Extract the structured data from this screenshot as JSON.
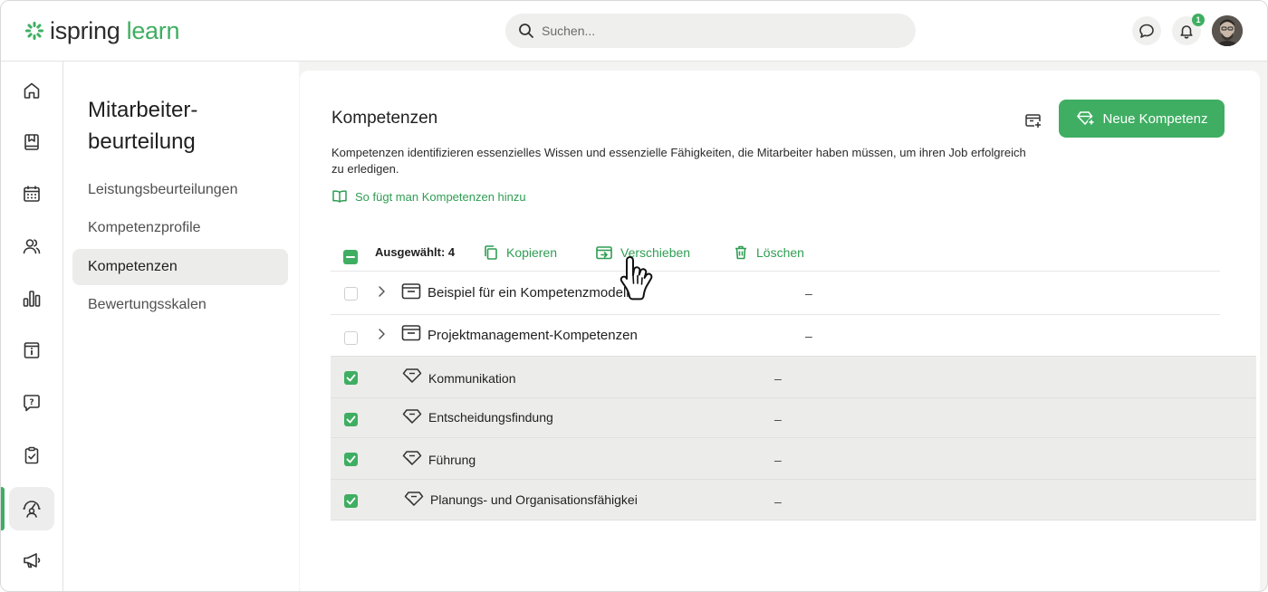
{
  "header": {
    "logo": {
      "part1": "ispring",
      "part2": "learn"
    },
    "search_placeholder": "Suchen...",
    "notification_count": "1"
  },
  "rail": {
    "items": [
      "home-icon",
      "book-icon",
      "calendar-icon",
      "users-icon",
      "chart-icon",
      "info-card-icon",
      "question-icon",
      "clipboard-check-icon",
      "evaluation-icon",
      "megaphone-icon"
    ],
    "active_index": 8
  },
  "subnav": {
    "title": "Mitarbeiter-beurteilung",
    "items": [
      "Leistungsbeurteilungen",
      "Kompetenzprofile",
      "Kompetenzen",
      "Bewertungsskalen"
    ],
    "active": "Kompetenzen"
  },
  "main": {
    "title": "Kompetenzen",
    "description": "Kompetenzen identifizieren essenzielles Wissen und essenzielle Fähigkeiten, die Mitarbeiter haben müssen, um ihren Job erfolgreich zu erledigen.",
    "howto_link": "So fügt man Kompetenzen hinzu",
    "new_button": "Neue Kompetenz",
    "toolbar": {
      "selected_label": "Ausgewählt: 4",
      "copy": "Kopieren",
      "move": "Verschieben",
      "delete": "Löschen"
    },
    "rows": [
      {
        "name": "Beispiel für ein Kompetenzmodell",
        "type": "folder",
        "checked": false,
        "value": "–"
      },
      {
        "name": "Projektmanagement-Kompetenzen",
        "type": "folder",
        "checked": false,
        "value": "–"
      },
      {
        "name": "Kommunikation",
        "type": "competency",
        "checked": true,
        "value": "–"
      },
      {
        "name": "Entscheidungsfindung",
        "type": "competency",
        "checked": true,
        "value": "–"
      },
      {
        "name": "Führung",
        "type": "competency",
        "checked": true,
        "value": "–"
      },
      {
        "name": "Planungs- und Organisationsfähigkeit",
        "type": "competency",
        "checked": true,
        "value": "–"
      }
    ]
  },
  "colors": {
    "accent": "#3fae62",
    "selected_row": "#ececeb"
  }
}
